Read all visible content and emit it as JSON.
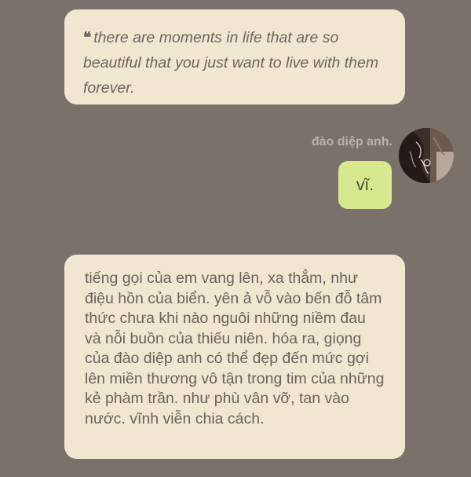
{
  "quote_card": {
    "quote_mark": "❝",
    "text": "there are moments in life that are so beautiful that you just want to live with them forever."
  },
  "message": {
    "sender_name": "đào diệp anh.",
    "text": "vĩ."
  },
  "body_card": {
    "text": "tiếng gọi của em vang lên, xa thẳm, như điệu hồn của biển. yên ả vỗ vào bến đỗ tâm thức chưa khi nào nguôi những niềm đau và nỗi buồn của thiếu niên. hóa ra, giọng của đào diệp anh có thể đẹp đến mức gợi lên miền thương vô tận trong tim của những kẻ phàm trần. như phù vân vỡ, tan vào nước. vĩnh viễn chia cách."
  },
  "colors": {
    "background": "#7a716b",
    "card": "#f1e6cf",
    "bubble": "#d8e88f",
    "sender_name": "#b9b0a9"
  }
}
